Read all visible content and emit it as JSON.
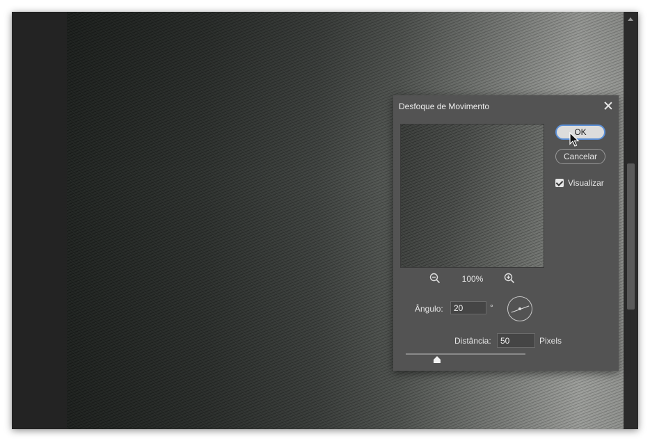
{
  "dialog": {
    "title": "Desfoque de Movimento",
    "ok_label": "OK",
    "cancel_label": "Cancelar",
    "preview_checkbox_label": "Visualizar",
    "preview_checked": true,
    "zoom_level": "100%",
    "angle_label": "Ângulo:",
    "angle_value": "20",
    "angle_unit": "°",
    "distance_label": "Distância:",
    "distance_value": "50",
    "distance_unit": "Pixels"
  },
  "icons": {
    "close": "close-icon",
    "zoom_out": "zoom-out-icon",
    "zoom_in": "zoom-in-icon",
    "angle_dial": "angle-dial-icon",
    "cursor": "mouse-cursor-icon"
  },
  "colors": {
    "dialog_bg": "#535353",
    "ok_focus_ring": "#5b8fd6",
    "app_bg": "#1e1e1e"
  }
}
